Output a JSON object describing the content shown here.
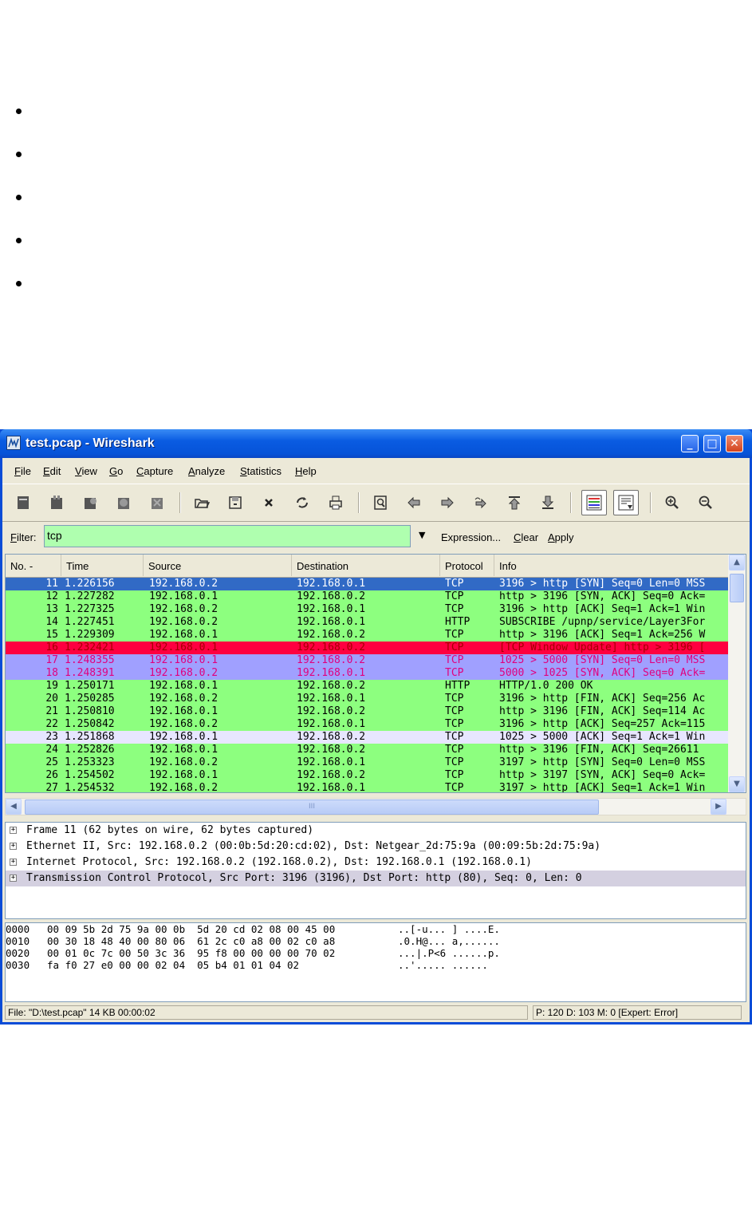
{
  "window": {
    "title": "test.pcap - Wireshark",
    "minimize": "_",
    "maximize": "□",
    "close": "✕"
  },
  "menu": [
    {
      "ul": "F",
      "rest": "ile"
    },
    {
      "ul": "E",
      "rest": "dit"
    },
    {
      "ul": "V",
      "rest": "iew"
    },
    {
      "ul": "G",
      "rest": "o"
    },
    {
      "ul": "C",
      "rest": "apture"
    },
    {
      "ul": "A",
      "rest": "nalyze"
    },
    {
      "ul": "S",
      "rest": "tatistics"
    },
    {
      "ul": "H",
      "rest": "elp"
    }
  ],
  "toolbar_icons": [
    "interface-list-icon",
    "capture-options-icon",
    "start-capture-icon",
    "stop-capture-icon",
    "restart-capture-icon",
    "open-file-icon",
    "save-file-icon",
    "close-file-icon",
    "reload-icon",
    "print-icon",
    "find-packet-icon",
    "go-back-icon",
    "go-forward-icon",
    "go-to-packet-icon",
    "first-packet-icon",
    "last-packet-icon",
    "colorize-icon",
    "auto-scroll-icon",
    "zoom-in-icon",
    "zoom-out-icon"
  ],
  "filter": {
    "label_ul": "F",
    "label_rest": "ilter:",
    "value": "tcp",
    "expression": "Expression...",
    "clear_ul": "C",
    "clear_rest": "lear",
    "apply_ul": "A",
    "apply_rest": "pply"
  },
  "packet_list": {
    "columns": [
      "No. -",
      "Time",
      "Source",
      "Destination",
      "Protocol",
      "Info"
    ],
    "rows": [
      {
        "no": "11",
        "time": "1.226156",
        "src": "192.168.0.2",
        "dst": "192.168.0.1",
        "proto": "TCP",
        "info": "3196 > http [SYN] Seq=0 Len=0 MSS",
        "bg": "#316AC5",
        "fg": "#FFFFFF"
      },
      {
        "no": "12",
        "time": "1.227282",
        "src": "192.168.0.1",
        "dst": "192.168.0.2",
        "proto": "TCP",
        "info": "http > 3196 [SYN, ACK] Seq=0 Ack=",
        "bg": "#8DFF7F",
        "fg": "#000000"
      },
      {
        "no": "13",
        "time": "1.227325",
        "src": "192.168.0.2",
        "dst": "192.168.0.1",
        "proto": "TCP",
        "info": "3196 > http [ACK] Seq=1 Ack=1 Win",
        "bg": "#8DFF7F",
        "fg": "#000000"
      },
      {
        "no": "14",
        "time": "1.227451",
        "src": "192.168.0.2",
        "dst": "192.168.0.1",
        "proto": "HTTP",
        "info": "SUBSCRIBE /upnp/service/Layer3For",
        "bg": "#8DFF7F",
        "fg": "#000000"
      },
      {
        "no": "15",
        "time": "1.229309",
        "src": "192.168.0.1",
        "dst": "192.168.0.2",
        "proto": "TCP",
        "info": "http > 3196 [ACK] Seq=1 Ack=256 W",
        "bg": "#8DFF7F",
        "fg": "#000000"
      },
      {
        "no": "16",
        "time": "1.232421",
        "src": "192.168.0.1",
        "dst": "192.168.0.2",
        "proto": "TCP",
        "info": "[TCP Window Update] http > 3196 [",
        "bg": "#FF0040",
        "fg": "#A40000"
      },
      {
        "no": "17",
        "time": "1.248355",
        "src": "192.168.0.1",
        "dst": "192.168.0.2",
        "proto": "TCP",
        "info": "1025 > 5000 [SYN] Seq=0 Len=0 MSS",
        "bg": "#A0A0FF",
        "fg": "#E0007F"
      },
      {
        "no": "18",
        "time": "1.248391",
        "src": "192.168.0.2",
        "dst": "192.168.0.1",
        "proto": "TCP",
        "info": "5000 > 1025 [SYN, ACK] Seq=0 Ack=",
        "bg": "#A0A0FF",
        "fg": "#E0007F"
      },
      {
        "no": "19",
        "time": "1.250171",
        "src": "192.168.0.1",
        "dst": "192.168.0.2",
        "proto": "HTTP",
        "info": "HTTP/1.0 200 OK",
        "bg": "#8DFF7F",
        "fg": "#000000"
      },
      {
        "no": "20",
        "time": "1.250285",
        "src": "192.168.0.2",
        "dst": "192.168.0.1",
        "proto": "TCP",
        "info": "3196 > http [FIN, ACK] Seq=256 Ac",
        "bg": "#8DFF7F",
        "fg": "#000000"
      },
      {
        "no": "21",
        "time": "1.250810",
        "src": "192.168.0.1",
        "dst": "192.168.0.2",
        "proto": "TCP",
        "info": "http > 3196 [FIN, ACK] Seq=114 Ac",
        "bg": "#8DFF7F",
        "fg": "#000000"
      },
      {
        "no": "22",
        "time": "1.250842",
        "src": "192.168.0.2",
        "dst": "192.168.0.1",
        "proto": "TCP",
        "info": "3196 > http [ACK] Seq=257 Ack=115",
        "bg": "#8DFF7F",
        "fg": "#000000"
      },
      {
        "no": "23",
        "time": "1.251868",
        "src": "192.168.0.1",
        "dst": "192.168.0.2",
        "proto": "TCP",
        "info": "1025 > 5000 [ACK] Seq=1 Ack=1 Win",
        "bg": "#E7E6FF",
        "fg": "#000000"
      },
      {
        "no": "24",
        "time": "1.252826",
        "src": "192.168.0.1",
        "dst": "192.168.0.2",
        "proto": "TCP",
        "info": "http > 3196 [FIN, ACK] Seq=26611",
        "bg": "#8DFF7F",
        "fg": "#000000"
      },
      {
        "no": "25",
        "time": "1.253323",
        "src": "192.168.0.2",
        "dst": "192.168.0.1",
        "proto": "TCP",
        "info": "3197 > http [SYN] Seq=0 Len=0 MSS",
        "bg": "#8DFF7F",
        "fg": "#000000"
      },
      {
        "no": "26",
        "time": "1.254502",
        "src": "192.168.0.1",
        "dst": "192.168.0.2",
        "proto": "TCP",
        "info": "http > 3197 [SYN, ACK] Seq=0 Ack=",
        "bg": "#8DFF7F",
        "fg": "#000000"
      },
      {
        "no": "27",
        "time": "1.254532",
        "src": "192.168.0.2",
        "dst": "192.168.0.1",
        "proto": "TCP",
        "info": "3197 > http [ACK] Seq=1 Ack=1 Win",
        "bg": "#8DFF7F",
        "fg": "#000000"
      }
    ],
    "hscroll_grip": "III"
  },
  "details": [
    {
      "text": "Frame 11 (62 bytes on wire, 62 bytes captured)",
      "expander": "+",
      "selected": false
    },
    {
      "text": "Ethernet II, Src: 192.168.0.2 (00:0b:5d:20:cd:02), Dst: Netgear_2d:75:9a (00:09:5b:2d:75:9a)",
      "expander": "+",
      "selected": false
    },
    {
      "text": "Internet Protocol, Src: 192.168.0.2 (192.168.0.2), Dst: 192.168.0.1 (192.168.0.1)",
      "expander": "+",
      "selected": false
    },
    {
      "text": "Transmission Control Protocol, Src Port: 3196 (3196), Dst Port: http (80), Seq: 0, Len: 0",
      "expander": "+",
      "selected": true
    }
  ],
  "hex": [
    {
      "offset": "0000",
      "hex": "00 09 5b 2d 75 9a 00 0b  5d 20 cd 02 08 00 45 00",
      "ascii": "..[-u... ] ....E."
    },
    {
      "offset": "0010",
      "hex": "00 30 18 48 40 00 80 06  61 2c c0 a8 00 02 c0 a8",
      "ascii": ".0.H@... a,......"
    },
    {
      "offset": "0020",
      "hex": "00 01 0c 7c 00 50 3c 36  95 f8 00 00 00 00 70 02",
      "ascii": "...|.P<6 ......p."
    },
    {
      "offset": "0030",
      "hex": "fa f0 27 e0 00 00 02 04  05 b4 01 01 04 02",
      "ascii": "..'..... ......"
    }
  ],
  "status": {
    "file": "File: \"D:\\test.pcap\" 14 KB 00:00:02",
    "packets": "P: 120 D: 103 M: 0 [Expert: Error]"
  }
}
